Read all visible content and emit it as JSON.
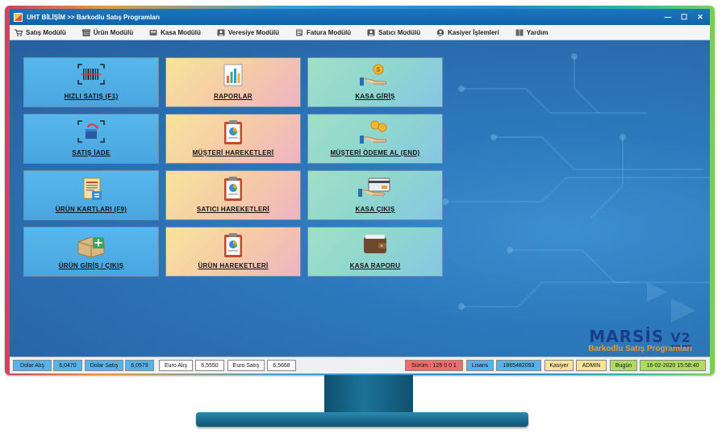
{
  "window": {
    "app_name": "UHT BİLİŞİM",
    "separator": ">>",
    "subtitle": "Barkodlu Satış Programları",
    "minimize_glyph": "—",
    "maximize_glyph": "☐",
    "close_glyph": "✕"
  },
  "menu": {
    "items": [
      {
        "label": "Satış Modülü",
        "icon": "cart-icon"
      },
      {
        "label": "Ürün Modülü",
        "icon": "box-icon"
      },
      {
        "label": "Kasa Modülü",
        "icon": "cash-register-icon"
      },
      {
        "label": "Veresiye Modülü",
        "icon": "person-card-icon"
      },
      {
        "label": "Fatura Modülü",
        "icon": "invoice-icon"
      },
      {
        "label": "Satıcı Modülü",
        "icon": "seller-icon"
      },
      {
        "label": "Kasiyer İşlemleri",
        "icon": "user-circle-icon"
      },
      {
        "label": "Yardım",
        "icon": "help-book-icon"
      }
    ]
  },
  "tiles": [
    {
      "label": "HIZLI SATIŞ (F1)",
      "icon": "barcode-icon",
      "color": "blue"
    },
    {
      "label": "RAPORLAR",
      "icon": "bar-chart-icon",
      "color": "peach"
    },
    {
      "label": "KASA GİRİŞ",
      "icon": "hand-coin-icon",
      "color": "teal"
    },
    {
      "label": "SATIŞ İADE",
      "icon": "return-box-icon",
      "color": "blue"
    },
    {
      "label": "MÜŞTERİ HAREKETLERİ",
      "icon": "clipboard-pie-icon",
      "color": "peach"
    },
    {
      "label": "MÜŞTERİ ÖDEME AL (END)",
      "icon": "hand-coins-icon",
      "color": "teal"
    },
    {
      "label": "ÜRÜN KARTLARI (F9)",
      "icon": "product-cards-icon",
      "color": "blue"
    },
    {
      "label": "SATICI HAREKETLERİ",
      "icon": "clipboard-pie-icon",
      "color": "peach"
    },
    {
      "label": "KASA ÇIKIŞ",
      "icon": "hand-card-icon",
      "color": "teal"
    },
    {
      "label": "ÜRÜN GİRİŞ / ÇIKIŞ",
      "icon": "box-plus-icon",
      "color": "blue"
    },
    {
      "label": "ÜRÜN HAREKETLERİ",
      "icon": "clipboard-pie-icon",
      "color": "peach"
    },
    {
      "label": "KASA RAPORU",
      "icon": "wallet-icon",
      "color": "teal"
    }
  ],
  "logo": {
    "name": "MARSİS",
    "version_mark": "V2",
    "tagline": "Barkodlu Satış Programları"
  },
  "status": {
    "dolar_alis_label": "Dolar Alış",
    "dolar_alis_value": "6,0470",
    "dolar_satis_label": "Dolar Satış",
    "dolar_satis_value": "6,0579",
    "euro_alis_label": "Euro Alış",
    "euro_alis_value": "6,5550",
    "euro_satis_label": "Euro Satış",
    "euro_satis_value": "6,5668",
    "surum_label": "Sürüm : 125 0 0 1",
    "lisans_label": "Lisans",
    "lisans_value": "1865482093",
    "kasiyer_label": "Kasiyer",
    "kasiyer_value": "ADMIN",
    "bugun_label": "Bugün",
    "datetime": "16-02-2020 15:58:40"
  },
  "colors": {
    "accent_blue": "#57b2ea",
    "status_red": "#f06b6b",
    "status_yellow": "#f7e49a",
    "status_green": "#aedc63",
    "logo_blue": "#1a3f8a",
    "logo_orange": "#e89a2a"
  }
}
